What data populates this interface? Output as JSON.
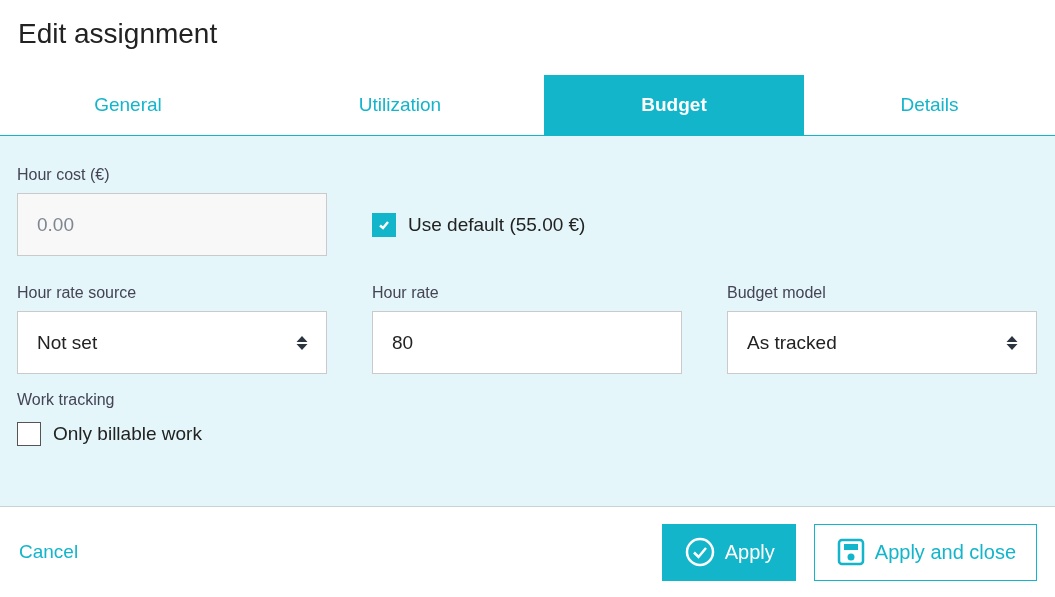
{
  "dialog": {
    "title": "Edit assignment"
  },
  "tabs": [
    {
      "label": "General",
      "selected": false
    },
    {
      "label": "Utilization",
      "selected": false
    },
    {
      "label": "Budget",
      "selected": true
    },
    {
      "label": "Details",
      "selected": false
    }
  ],
  "hour_cost": {
    "label": "Hour cost (€)",
    "value": "0.00",
    "disabled": true
  },
  "use_default": {
    "label": "Use default (55.00 €)",
    "checked": true
  },
  "fields": [
    {
      "kind": "select",
      "label": "Hour rate source",
      "value": "Not set"
    },
    {
      "kind": "input",
      "label": "Hour rate",
      "value": "80"
    },
    {
      "kind": "select",
      "label": "Budget model",
      "value": "As tracked"
    }
  ],
  "work_tracking": {
    "label": "Work tracking",
    "option": {
      "label": "Only billable work",
      "checked": false
    }
  },
  "footer": {
    "cancel": "Cancel",
    "apply": "Apply",
    "apply_close": "Apply and close"
  }
}
